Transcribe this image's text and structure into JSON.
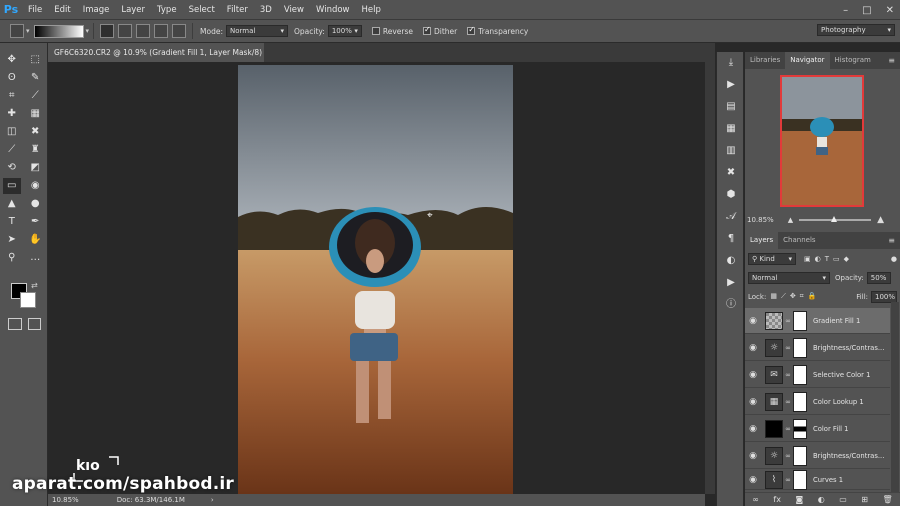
{
  "app": {
    "logo": "Ps"
  },
  "menu": [
    "File",
    "Edit",
    "Image",
    "Layer",
    "Type",
    "Select",
    "Filter",
    "3D",
    "View",
    "Window",
    "Help"
  ],
  "window_controls": [
    "–",
    "□",
    "✕"
  ],
  "options": {
    "mode_label": "Mode:",
    "mode_value": "Normal",
    "opacity_label": "Opacity:",
    "opacity_value": "100%",
    "reverse_label": "Reverse",
    "dither_label": "Dither",
    "transparency_label": "Transparency",
    "reverse_checked": false,
    "dither_checked": true,
    "transparency_checked": true,
    "workspace": "Photography"
  },
  "document": {
    "tab_title": "GF6C6320.CR2 @ 10.9% (Gradient Fill 1, Layer Mask/8) *",
    "tab_close": "×"
  },
  "status": {
    "zoom": "10.85%",
    "doc": "Doc: 63.3M/146.1M",
    "arrow": "›"
  },
  "watermark": {
    "text": "aparat.com/spahbod.ir",
    "logo_text": "kıo"
  },
  "top_panel": {
    "tabs": [
      "Libraries",
      "Navigator",
      "Histogram"
    ],
    "active_tab": "Navigator",
    "zoom": "10.85%"
  },
  "layers_panel": {
    "tabs": [
      "Layers",
      "Channels"
    ],
    "active_tab": "Layers",
    "filter_kind": "Kind",
    "blend_mode": "Normal",
    "opacity_label": "Opacity:",
    "opacity_value": "50%",
    "lock_label": "Lock:",
    "fill_label": "Fill:",
    "fill_value": "100%",
    "layers": [
      {
        "name": "Gradient Fill 1",
        "thumb": "gradient-icon",
        "selected": true
      },
      {
        "name": "Brightness/Contras...",
        "thumb": "sun-icon",
        "selected": false
      },
      {
        "name": "Selective Color 1",
        "thumb": "selective-color-icon",
        "selected": false
      },
      {
        "name": "Color Lookup 1",
        "thumb": "grid-icon",
        "selected": false
      },
      {
        "name": "Color Fill 1",
        "thumb": "black-fill",
        "selected": false
      },
      {
        "name": "Brightness/Contras...",
        "thumb": "sun-icon",
        "selected": false
      },
      {
        "name": "Curves 1",
        "thumb": "curves-icon",
        "selected": false
      }
    ]
  },
  "colors": {
    "accent": "#31a8ff",
    "panel": "#535353",
    "canvas": "#282828",
    "nav_frame": "#e23a3a"
  }
}
